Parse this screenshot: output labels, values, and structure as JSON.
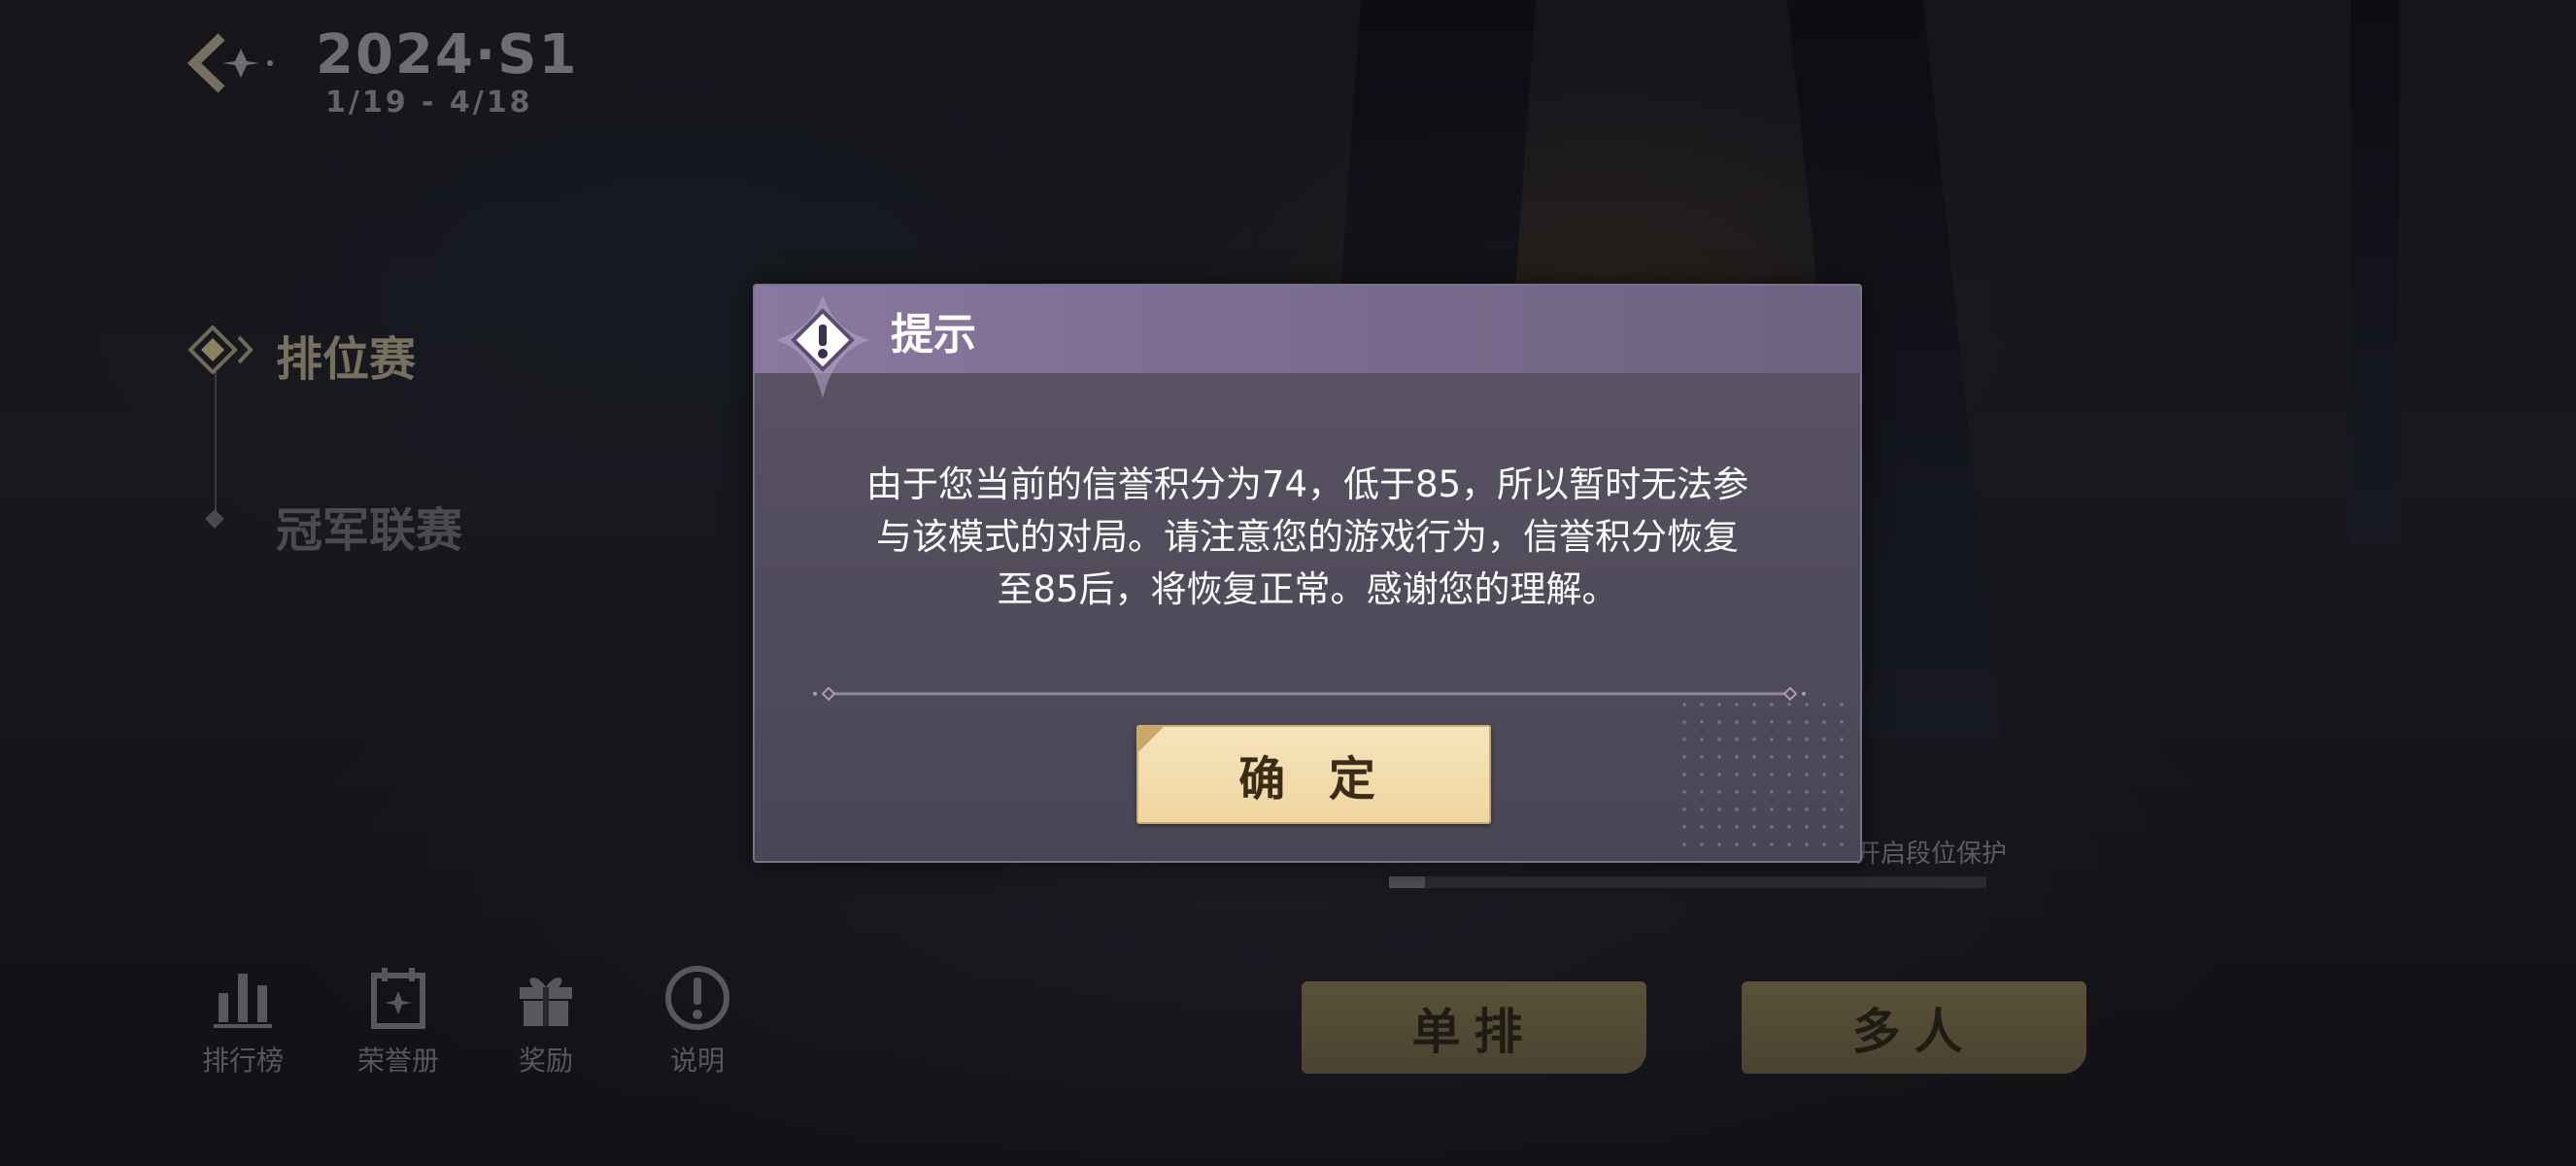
{
  "season": {
    "title": "2024·S1",
    "dates": "1/19 - 4/18"
  },
  "menu": {
    "items": [
      {
        "label": "排位赛",
        "active": true
      },
      {
        "label": "冠军联赛",
        "active": false
      }
    ]
  },
  "bottom_nav": [
    {
      "label": "排行榜",
      "icon": "bar-chart-icon"
    },
    {
      "label": "荣誉册",
      "icon": "honor-book-icon"
    },
    {
      "label": "奖励",
      "icon": "gift-icon"
    },
    {
      "label": "说明",
      "icon": "info-icon"
    }
  ],
  "rank_progress": {
    "text": "开启段位保护"
  },
  "mode_buttons": {
    "solo": "单排",
    "multi": "多人"
  },
  "dialog": {
    "title": "提示",
    "message_lines": [
      "由于您当前的信誉积分为74，低于85，所以暂时无法参",
      "与该模式的对局。请注意您的游戏行为，信誉积分恢复",
      "至85后，将恢复正常。感谢您的理解。"
    ],
    "confirm_label": "确 定",
    "icon": "warning-icon"
  },
  "colors": {
    "dialog_header": "#8a799f",
    "confirm_button": "#f3dfaf",
    "background": "#1c1b21"
  }
}
